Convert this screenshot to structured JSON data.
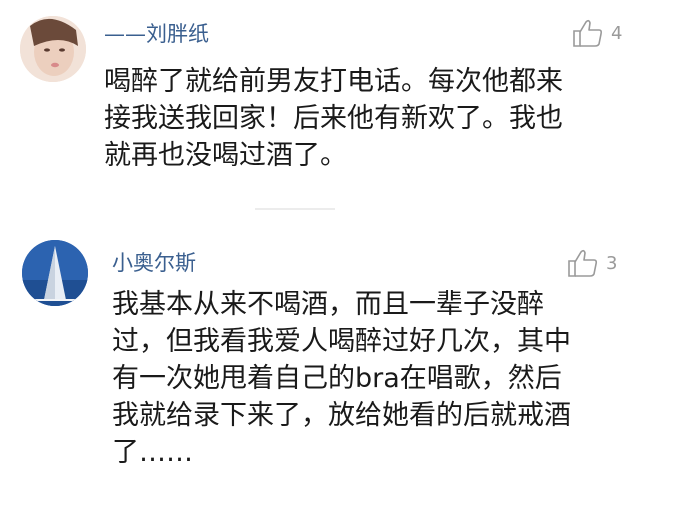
{
  "comments": [
    {
      "username": "——刘胖纸",
      "likes": "4",
      "avatar_icon": "avatar-photo-face",
      "lines": [
        "喝醉了就给前男友打电话。每次他都来",
        "接我送我回家！后来他有新欢了。我也",
        "就再也没喝过酒了。"
      ]
    },
    {
      "username": "小奥尔斯",
      "likes": "3",
      "avatar_icon": "avatar-architecture",
      "lines": [
        "我基本从来不喝酒，而且一辈子没醉",
        "过，但我看我爱人喝醉过好几次，其中",
        "有一次她甩着自己的bra在唱歌，然后",
        "我就给录下来了，放给她看的后就戒酒",
        "了……"
      ]
    }
  ],
  "colors": {
    "username": "#3a5f8f",
    "text": "#1a1a1a",
    "meta": "#9a9a9a"
  }
}
